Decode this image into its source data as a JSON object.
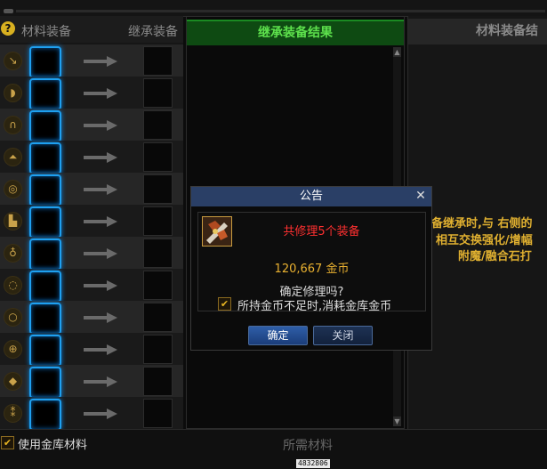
{
  "left_panel": {
    "header_material": "材料装备",
    "header_inherit": "继承装备",
    "rows": [
      {
        "icon": "weapon-icon",
        "glyph": "↘"
      },
      {
        "icon": "armor-icon",
        "glyph": "◗"
      },
      {
        "icon": "pants-icon",
        "glyph": "∩"
      },
      {
        "icon": "shoulder-icon",
        "glyph": "⏶"
      },
      {
        "icon": "belt-icon",
        "glyph": "◎"
      },
      {
        "icon": "boots-icon",
        "glyph": "▙"
      },
      {
        "icon": "necklace-icon",
        "glyph": "♁"
      },
      {
        "icon": "bracelet-icon",
        "glyph": "◌"
      },
      {
        "icon": "ring-icon",
        "glyph": "○"
      },
      {
        "icon": "support-icon",
        "glyph": "⊕"
      },
      {
        "icon": "magic-stone-icon",
        "glyph": "◆"
      },
      {
        "icon": "earring-icon",
        "glyph": "⁑"
      }
    ],
    "use_vault_material_label": "使用金库材料",
    "use_vault_material_checked": true
  },
  "middle_panel": {
    "title": "继承装备结果"
  },
  "right_panel": {
    "title": "材料装备结",
    "desc_line1": "备继承时,与 右侧的",
    "desc_line2": "相互交换强化/增幅",
    "desc_line3": "附魔/融合石打"
  },
  "bottom": {
    "required_material_label": "所需材料",
    "code": "4832806"
  },
  "dialog": {
    "title": "公告",
    "repair_text": "共修理5个装备",
    "gold_amount": "120,667 金币",
    "confirm_question": "确定修理吗?",
    "use_vault_gold_label": "所持金币不足时,消耗金库金币",
    "use_vault_gold_checked": true,
    "ok_label": "确定",
    "close_label": "关闭"
  },
  "colors": {
    "slot_glow": "#1ea0f0",
    "header_green": "#5de04c",
    "dialog_title_bg": "#2a3f66",
    "repair_red": "#ff3030",
    "gold": "#e8b030"
  }
}
